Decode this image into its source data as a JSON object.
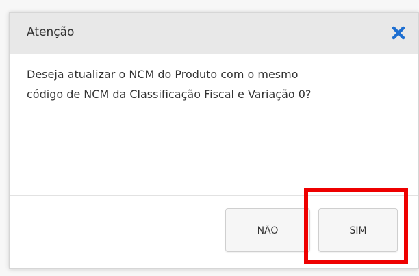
{
  "dialog": {
    "title": "Atenção",
    "message_line1": "Deseja atualizar o NCM do Produto com o mesmo",
    "message_line2": "código de NCM da Classificação Fiscal e Variação 0?",
    "no_label": "NÃO",
    "yes_label": "SIM",
    "close_icon": "close-icon"
  },
  "colors": {
    "header_bg": "#e8e8e8",
    "close_icon": "#1e6fd1",
    "highlight": "#ee0000",
    "text": "#333333"
  }
}
